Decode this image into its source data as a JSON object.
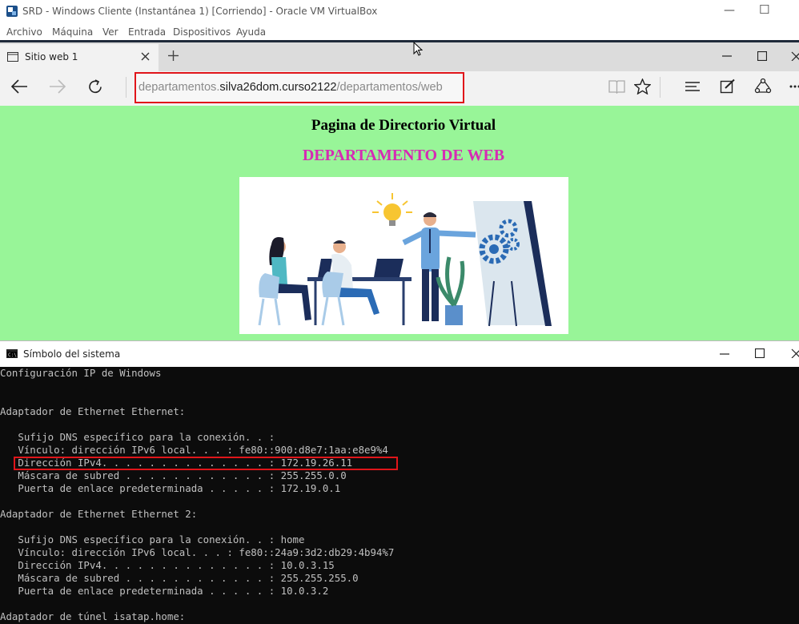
{
  "virtualbox": {
    "title": "SRD - Windows Cliente (Instantánea 1) [Corriendo] - Oracle VM VirtualBox",
    "menu": [
      "Archivo",
      "Máquina",
      "Ver",
      "Entrada",
      "Dispositivos",
      "Ayuda"
    ]
  },
  "browser": {
    "tab_title": "Sitio web 1",
    "url_prefix": "departamentos.",
    "url_domain": "silva26dom.curso2122",
    "url_path": "/departamentos/web"
  },
  "page": {
    "heading": "Pagina de Directorio Virtual",
    "subheading": "DEPARTAMENTO DE WEB"
  },
  "cmd": {
    "title": "Símbolo del sistema",
    "lines": [
      "Configuración IP de Windows",
      "",
      "",
      "Adaptador de Ethernet Ethernet:",
      "",
      "   Sufijo DNS específico para la conexión. . :",
      "   Vínculo: dirección IPv6 local. . . : fe80::900:d8e7:1aa:e8e9%4",
      "   Dirección IPv4. . . . . . . . . . . . . . : 172.19.26.11",
      "   Máscara de subred . . . . . . . . . . . . : 255.255.0.0",
      "   Puerta de enlace predeterminada . . . . . : 172.19.0.1",
      "",
      "Adaptador de Ethernet Ethernet 2:",
      "",
      "   Sufijo DNS específico para la conexión. . : home",
      "   Vínculo: dirección IPv6 local. . . : fe80::24a9:3d2:db29:4b94%7",
      "   Dirección IPv4. . . . . . . . . . . . . . : 10.0.3.15",
      "   Máscara de subred . . . . . . . . . . . . : 255.255.255.0",
      "   Puerta de enlace predeterminada . . . . . : 10.0.3.2",
      "",
      "Adaptador de túnel isatap.home:"
    ]
  },
  "colors": {
    "page_bg": "#98f598",
    "subheading": "#d62bb4",
    "highlight_box": "#e0151a"
  }
}
